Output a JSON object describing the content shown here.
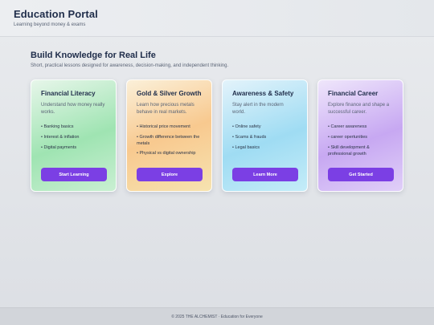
{
  "header": {
    "title": "Education Portal",
    "subtitle": "Learning beyond money & exams"
  },
  "hero": {
    "title": "Build Knowledge for Real Life",
    "subtitle": "Short, practical lessons designed for awareness, decision-making, and independent thinking."
  },
  "cards": [
    {
      "title": "Financial Literacy",
      "description": "Understand how money really works.",
      "items": [
        "Banking basics",
        "Interest & inflation",
        "Digital payments"
      ],
      "button": "Start Learning"
    },
    {
      "title": "Gold & Silver Growth",
      "description": "Learn how precious metals behave in real markets.",
      "items": [
        "Historical price movement",
        "Growth difference between the metals",
        "Physical vs digital ownership"
      ],
      "button": "Explore"
    },
    {
      "title": "Awareness & Safety",
      "description": "Stay alert in the modern world.",
      "items": [
        "Online safety",
        "Scams & frauds",
        "Legal basics"
      ],
      "button": "Learn More"
    },
    {
      "title": "Financial Career",
      "description": "Explore finance and shape a successful career.",
      "items": [
        "Career awareness",
        "career opertunities",
        "Skill development & professional growth"
      ],
      "button": "Get Started"
    }
  ],
  "footer": {
    "text": "© 2025 THE ALCHEMIST · Education for Everyone"
  },
  "colors": {
    "accent": "#7b3fe4",
    "title_text": "#1f2d4a"
  }
}
